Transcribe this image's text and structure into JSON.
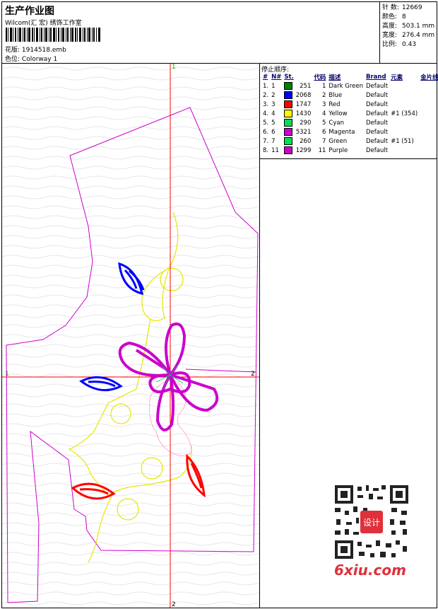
{
  "header": {
    "title": "生产作业图",
    "company": "Wilcom(汇 宏) 绣饰工作室",
    "design_label": "花版:",
    "design_value": "1914518.emb",
    "color_label": "色位:",
    "color_value": "Colorway 1"
  },
  "specs": [
    {
      "label": "针 数:",
      "value": "12669"
    },
    {
      "label": "颜色:",
      "value": "8"
    },
    {
      "label": "高度:",
      "value": "503.1 mm"
    },
    {
      "label": "宽度:",
      "value": "276.4 mm"
    },
    {
      "label": "比例:",
      "value": "0.43"
    }
  ],
  "stop_sequence": {
    "title": "停止顺序:",
    "columns": [
      "#",
      "N#",
      "St.",
      "代码",
      "描述",
      "Brand",
      "元素",
      "金片线"
    ],
    "rows": [
      {
        "idx": "1.",
        "n": "1",
        "color": "#008000",
        "st": "251",
        "code": "1",
        "desc": "Dark Green",
        "brand": "Default",
        "elem": "",
        "seq": ""
      },
      {
        "idx": "2.",
        "n": "2",
        "color": "#0000ff",
        "st": "2068",
        "code": "2",
        "desc": "Blue",
        "brand": "Default",
        "elem": "",
        "seq": ""
      },
      {
        "idx": "3.",
        "n": "3",
        "color": "#ff0000",
        "st": "1747",
        "code": "3",
        "desc": "Red",
        "brand": "Default",
        "elem": "",
        "seq": ""
      },
      {
        "idx": "4.",
        "n": "4",
        "color": "#ffff00",
        "st": "1430",
        "code": "4",
        "desc": "Yellow",
        "brand": "Default",
        "elem": "#1 (354)",
        "seq": ""
      },
      {
        "idx": "5.",
        "n": "5",
        "color": "#00e050",
        "st": "290",
        "code": "5",
        "desc": "Cyan",
        "brand": "Default",
        "elem": "",
        "seq": ""
      },
      {
        "idx": "6.",
        "n": "6",
        "color": "#cc00cc",
        "st": "5321",
        "code": "6",
        "desc": "Magenta",
        "brand": "Default",
        "elem": "",
        "seq": ""
      },
      {
        "idx": "7.",
        "n": "7",
        "color": "#00e050",
        "st": "260",
        "code": "7",
        "desc": "Green",
        "brand": "Default",
        "elem": "#1 (51)",
        "seq": ""
      },
      {
        "idx": "8.",
        "n": "11",
        "color": "#cc00cc",
        "st": "1299",
        "code": "11",
        "desc": "Purple",
        "brand": "Default",
        "elem": "",
        "seq": ""
      }
    ]
  },
  "guides": {
    "left": "1",
    "right": "2",
    "top": "1",
    "bottom": "2"
  },
  "watermark": {
    "brand": "6xiu.com",
    "seal": "设计"
  }
}
